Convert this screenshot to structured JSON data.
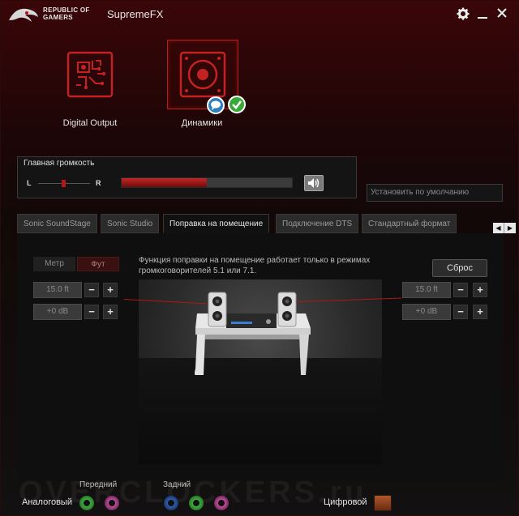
{
  "titlebar": {
    "brand_line1": "REPUBLIC OF",
    "brand_line2": "GAMERS",
    "app_title": "SupremeFX",
    "settings_icon": "gear-icon",
    "minimize_icon": "minimize-icon",
    "close_icon": "close-icon"
  },
  "devices": [
    {
      "label": "Digital Output",
      "icon": "digital-output-icon",
      "selected": false
    },
    {
      "label": "Динамики",
      "icon": "speaker-icon",
      "selected": true
    }
  ],
  "volume": {
    "title": "Главная громкость",
    "left_label": "L",
    "right_label": "R",
    "level": 0.5,
    "mute_icon": "speaker-volume-icon"
  },
  "default_button": "Установить по умолчанию",
  "tabs": [
    {
      "label": "Sonic SoundStage",
      "active": false
    },
    {
      "label": "Sonic Studio",
      "active": false
    },
    {
      "label": "Поправка на помещение",
      "active": true
    },
    {
      "label": "Подключение DTS",
      "active": false
    },
    {
      "label": "Стандартный формат",
      "active": false
    }
  ],
  "room": {
    "unit_meter": "Метр",
    "unit_foot": "Фут",
    "note": "Функция поправки на помещение работает только в режимах громкоговорителей 5.1 или 7.1.",
    "reset": "Сброс",
    "left_distance": "15.0 ft",
    "left_gain": "+0 dB",
    "right_distance": "15.0 ft",
    "right_gain": "+0 dB",
    "minus": "−",
    "plus": "+"
  },
  "footer": {
    "analog": "Аналоговый",
    "front": "Передний",
    "rear": "Задний",
    "digital": "Цифровой"
  },
  "colors": {
    "accent": "#b32020",
    "jack_green": "#3fae3f",
    "jack_pink": "#c0509a",
    "jack_blue": "#2f5fb0"
  }
}
